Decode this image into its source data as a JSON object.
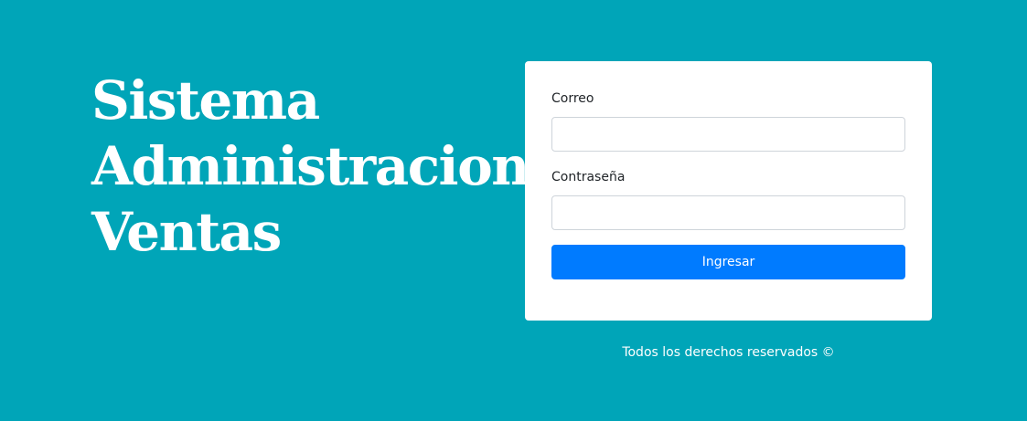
{
  "headline": {
    "lines": [
      "Sistema",
      "Administracion",
      "Ventas"
    ]
  },
  "login_form": {
    "email_label": "Correo",
    "email_value": "",
    "password_label": "Contraseña",
    "password_value": "",
    "submit_label": "Ingresar"
  },
  "footer": {
    "text": "Todos los derechos reservados ©"
  },
  "colors": {
    "background": "#00a5b8",
    "card": "#ffffff",
    "primary_button": "#007bff",
    "headline_text": "#ffffff"
  }
}
